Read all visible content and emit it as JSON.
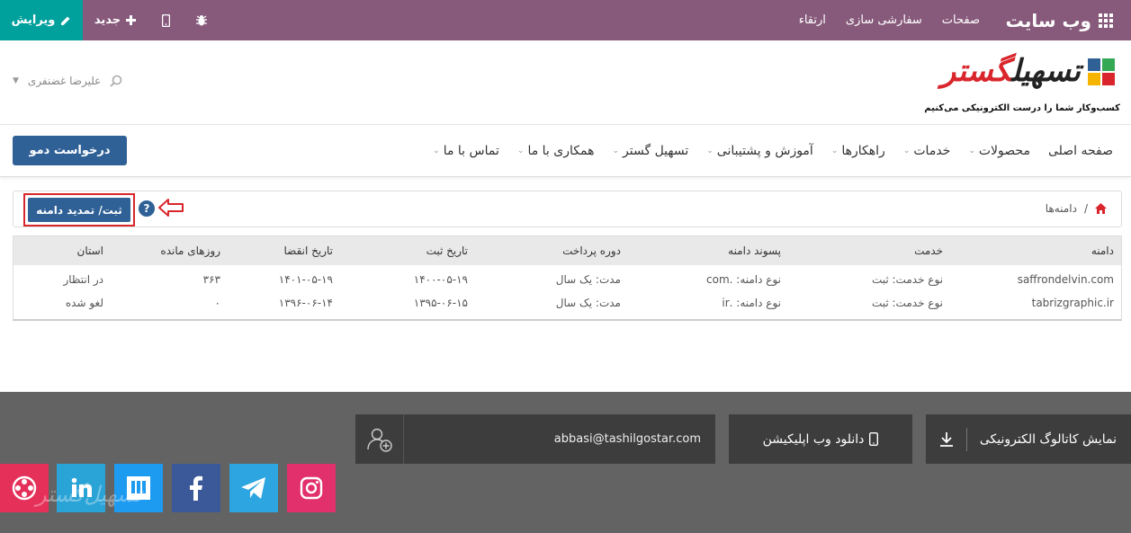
{
  "topbar": {
    "brand": "وب سایت",
    "menu": [
      "صفحات",
      "سفارشی سازی",
      "ارتقاء"
    ],
    "edit_label": "ویرایش",
    "new_label": "جدید",
    "color": "#875a7b",
    "edit_color": "#00a09d"
  },
  "header": {
    "logo_text_main": "تسهیل",
    "logo_text_accent": "گستر",
    "tagline": "کسب‌وکار شما را درست الکترونیکی می‌کنیم",
    "user_name": "علیرضا غضنفری"
  },
  "nav": {
    "items": [
      {
        "label": "صفحه اصلی",
        "dropdown": false
      },
      {
        "label": "محصولات",
        "dropdown": true
      },
      {
        "label": "خدمات",
        "dropdown": true
      },
      {
        "label": "راهکارها",
        "dropdown": true
      },
      {
        "label": "آموزش و پشتیبانی",
        "dropdown": true
      },
      {
        "label": "تسهیل گستر",
        "dropdown": true
      },
      {
        "label": "همکاری با ما",
        "dropdown": true
      },
      {
        "label": "تماس با ما",
        "dropdown": true
      }
    ],
    "demo_button": "درخواست دمو"
  },
  "breadcrumb": {
    "current": "دامنه‌ها",
    "register_button": "ثبت/ تمدید دامنه"
  },
  "table": {
    "headers": [
      "دامنه",
      "خدمت",
      "پسوند دامنه",
      "دوره پرداخت",
      "تاریخ ثبت",
      "تاریخ انقضا",
      "روزهای مانده",
      "استان"
    ],
    "rows": [
      [
        "saffrondelvin.com",
        "نوع خدمت: ثبت",
        "نوع دامنه: .com",
        "مدت: یک سال",
        "۱۴۰۰-۰۵-۱۹",
        "۱۴۰۱-۰۵-۱۹",
        "۳۶۳",
        "در انتظار"
      ],
      [
        "tabrizgraphic.ir",
        "نوع خدمت: ثبت",
        "نوع دامنه: .ir",
        "مدت: یک سال",
        "۱۳۹۵-۰۶-۱۵",
        "۱۳۹۶-۰۶-۱۴",
        "۰",
        "لغو شده"
      ]
    ]
  },
  "footer": {
    "catalog_label": "نمایش کاتالوگ الکترونیکی",
    "webapp_label": "دانلود وب اپلیکیشن",
    "email": "abbasi@tashilgostar.com",
    "watermark": "تسهیل‌گستر",
    "social": [
      "instagram-icon",
      "telegram-icon",
      "facebook-icon",
      "m-icon",
      "in-icon",
      "film-icon"
    ]
  }
}
